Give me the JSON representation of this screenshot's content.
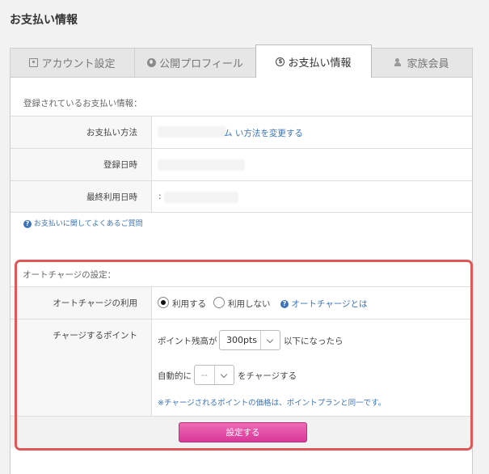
{
  "page_title": "お支払い情報",
  "tabs": [
    {
      "label": "アカウント設定",
      "icon": "account-icon",
      "active": false
    },
    {
      "label": "公開プロフィール",
      "icon": "globe-icon",
      "active": false
    },
    {
      "label": "お支払い情報",
      "icon": "coin-icon",
      "active": true
    },
    {
      "label": "家族会員",
      "icon": "family-icon",
      "active": false
    }
  ],
  "registered": {
    "heading": "登録されているお支払い情報：",
    "rows": {
      "method_label": "お支払い方法",
      "method_link": "ム い方法を変更する",
      "date_label": "登録日時",
      "last_used_label": "最終利用日時",
      "last_used_prefix": ":"
    },
    "faq_link": "お支払いに関してよくあるご質問"
  },
  "autocharge": {
    "heading": "オートチャージの設定：",
    "use_label": "オートチャージの利用",
    "option_use": "利用する",
    "option_not_use": "利用しない",
    "selected": "利用する",
    "what_link": "オートチャージとは",
    "points_label": "チャージするポイント",
    "balance_prefix": "ポイント残高が",
    "balance_value": "300pts",
    "balance_suffix": "以下になったら",
    "auto_prefix": "自動的に",
    "auto_value": "--",
    "auto_suffix": "をチャージする",
    "note": "※チャージされるポイントの価格は、ポイントプランと同一です。",
    "submit": "設定する"
  },
  "colors": {
    "highlight_border": "#e05757",
    "link": "#3b73b9",
    "button": "#d9389a"
  }
}
